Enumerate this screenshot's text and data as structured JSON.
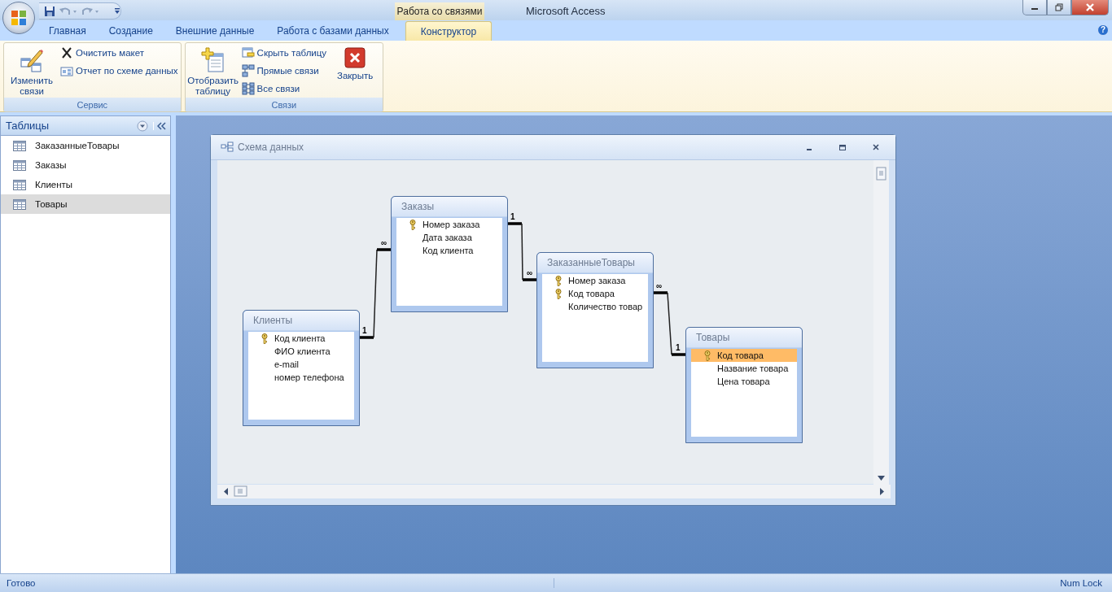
{
  "window": {
    "title": "Microsoft Access"
  },
  "contextual_tab_group": "Работа со связями",
  "tabs": [
    {
      "label": "Главная",
      "selected": false
    },
    {
      "label": "Создание",
      "selected": false
    },
    {
      "label": "Внешние данные",
      "selected": false
    },
    {
      "label": "Работа с базами данных",
      "selected": false
    },
    {
      "label": "Конструктор",
      "selected": true
    }
  ],
  "ribbon_groups": [
    {
      "label": "Сервис",
      "buttons": [
        {
          "label": "Изменить связи",
          "kind": "large"
        },
        {
          "label": "Очистить макет",
          "kind": "small"
        },
        {
          "label": "Отчет по схеме данных",
          "kind": "small"
        }
      ]
    },
    {
      "label": "Связи",
      "buttons": [
        {
          "label": "Отобразить таблицу",
          "kind": "large"
        },
        {
          "label": "Скрыть таблицу",
          "kind": "small"
        },
        {
          "label": "Прямые связи",
          "kind": "small"
        },
        {
          "label": "Все связи",
          "kind": "small"
        },
        {
          "label": "Закрыть",
          "kind": "large"
        }
      ]
    }
  ],
  "navigation_pane": {
    "title": "Таблицы",
    "items": [
      {
        "label": "ЗаказанныеТовары",
        "selected": false
      },
      {
        "label": "Заказы",
        "selected": false
      },
      {
        "label": "Клиенты",
        "selected": false
      },
      {
        "label": "Товары",
        "selected": true
      }
    ]
  },
  "diagram_window": {
    "title": "Схема данных",
    "tables": [
      {
        "name": "Заказы",
        "fields": [
          {
            "name": "Номер заказа",
            "key": true,
            "selected": false
          },
          {
            "name": "Дата заказа",
            "key": false,
            "selected": false
          },
          {
            "name": "Код клиента",
            "key": false,
            "selected": false
          }
        ]
      },
      {
        "name": "Клиенты",
        "fields": [
          {
            "name": "Код клиента",
            "key": true,
            "selected": false
          },
          {
            "name": "ФИО клиента",
            "key": false,
            "selected": false
          },
          {
            "name": "e-mail",
            "key": false,
            "selected": false
          },
          {
            "name": "номер  телефона",
            "key": false,
            "selected": false
          }
        ]
      },
      {
        "name": "ЗаказанныеТовары",
        "fields": [
          {
            "name": "Номер заказа",
            "key": true,
            "selected": false
          },
          {
            "name": "Код товара",
            "key": true,
            "selected": false
          },
          {
            "name": "Количество товар",
            "key": false,
            "selected": false
          }
        ]
      },
      {
        "name": "Товары",
        "fields": [
          {
            "name": "Код товара",
            "key": true,
            "selected": true
          },
          {
            "name": "Название товара",
            "key": false,
            "selected": false
          },
          {
            "name": "Цена товара",
            "key": false,
            "selected": false
          }
        ]
      }
    ],
    "relationships": [
      {
        "from_mark": "1",
        "to_mark": "∞"
      },
      {
        "from_mark": "1",
        "to_mark": "∞"
      },
      {
        "from_mark": "∞",
        "to_mark": "1"
      }
    ]
  },
  "help_button": "?",
  "status_bar": {
    "left": "Готово",
    "right": "Num Lock"
  }
}
